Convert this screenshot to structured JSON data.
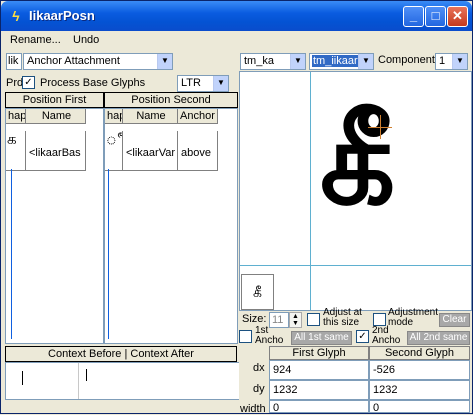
{
  "window": {
    "title": "IikaarPosn"
  },
  "menu": [
    "Rename...",
    "Undo"
  ],
  "left": {
    "small_field": "lik",
    "mode_select": "Anchor Attachment",
    "prd_label": "Prd",
    "process_base_label": "Process Base Glyphs",
    "direction_select": "LTR",
    "position_first_header": "Position First",
    "position_second_header": "Position Second",
    "first_cols": [
      "hap",
      "Name"
    ],
    "second_cols": [
      "hap",
      "Name",
      "Anchor"
    ],
    "first_row": {
      "glyph": "க",
      "name": "<likaarBas"
    },
    "second_row": {
      "glyph": "ீ",
      "name": "<likaarVar",
      "anchor": "above"
    },
    "context_header": "Context Before | Context After"
  },
  "right": {
    "glyph_select_a": "tm_ka",
    "glyph_select_b": "tm_iikaar",
    "component_label": "Component:",
    "component_value": "1",
    "preview_glyph": "கீ",
    "thumb_glyph": "கீ",
    "size_label": "Size:",
    "size_value": "11",
    "adjust_size_label": "Adjust at this size",
    "adjust_mode_label": "Adjustment mode",
    "clear_label": "Clear",
    "first_anchor_label": "1st Ancho",
    "all_first_label": "All 1st same",
    "second_anchor_label": "2nd Ancho",
    "all_second_label": "All 2nd same",
    "table_headers": [
      "First Glyph",
      "Second Glyph"
    ],
    "rows": [
      {
        "label": "dx",
        "first": "924",
        "second": "-526"
      },
      {
        "label": "dy",
        "first": "1232",
        "second": "1232"
      },
      {
        "label": "width",
        "first": "0",
        "second": "0"
      }
    ]
  },
  "colors": {
    "titlebar": "#0453d3",
    "guide_line": "#5fb0d0",
    "anchor_mark": "#d08030"
  }
}
